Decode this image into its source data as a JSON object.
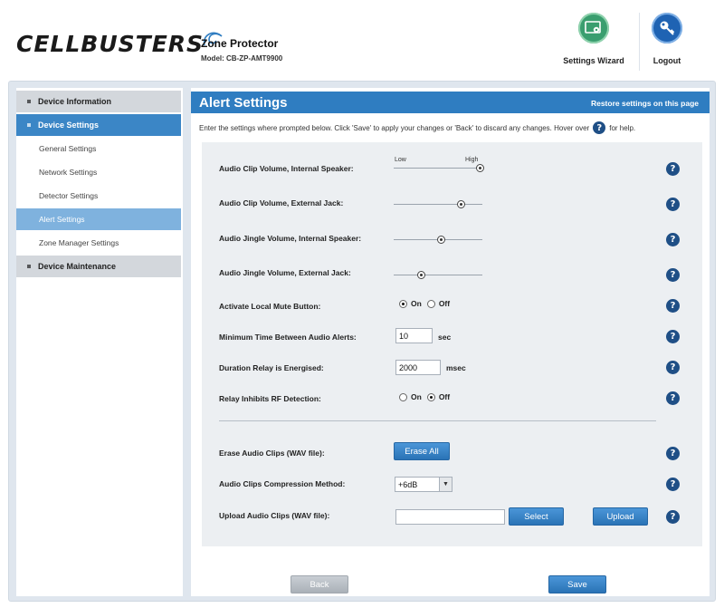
{
  "header": {
    "logo_text": "CELLBUSTERS",
    "product_title": "Zone Protector",
    "product_model": "Model: CB-ZP-AMT9900",
    "wizard_label": "Settings Wizard",
    "logout_label": "Logout",
    "wizard_icon": "settings-wizard-icon",
    "logout_icon": "key-icon"
  },
  "sidebar": {
    "items": [
      {
        "label": "Device Information",
        "type": "group",
        "active": false
      },
      {
        "label": "Device Settings",
        "type": "group",
        "active": true
      },
      {
        "label": "General Settings",
        "type": "sub",
        "active": false
      },
      {
        "label": "Network Settings",
        "type": "sub",
        "active": false
      },
      {
        "label": "Detector Settings",
        "type": "sub",
        "active": false
      },
      {
        "label": "Alert Settings",
        "type": "sub",
        "active": true
      },
      {
        "label": "Zone Manager Settings",
        "type": "sub",
        "active": false
      },
      {
        "label": "Device Maintenance",
        "type": "group",
        "active": false
      }
    ]
  },
  "main": {
    "title": "Alert Settings",
    "restore_link": "Restore settings on this page",
    "instructions_before": "Enter the settings where prompted below. Click 'Save' to apply your changes or 'Back' to discard any changes. Hover over",
    "instructions_after": "for help.",
    "help_glyph": "?"
  },
  "form": {
    "slider_low_label": "Low",
    "slider_high_label": "High",
    "sliders": [
      {
        "label": "Audio Clip Volume, Internal Speaker:",
        "value_fraction": 0.97
      },
      {
        "label": "Audio Clip Volume, External Jack:",
        "value_fraction": 0.75
      },
      {
        "label": "Audio Jingle Volume, Internal Speaker:",
        "value_fraction": 0.53
      },
      {
        "label": "Audio Jingle Volume, External Jack:",
        "value_fraction": 0.31
      }
    ],
    "local_mute": {
      "label": "Activate Local Mute Button:",
      "on_label": "On",
      "off_label": "Off",
      "selected": "On"
    },
    "min_time": {
      "label": "Minimum Time Between Audio Alerts:",
      "value": "10",
      "unit": "sec"
    },
    "relay_duration": {
      "label": "Duration Relay is Energised:",
      "value": "2000",
      "unit": "msec"
    },
    "relay_inhibits": {
      "label": "Relay Inhibits RF Detection:",
      "on_label": "On",
      "off_label": "Off",
      "selected": "Off"
    },
    "erase": {
      "label": "Erase Audio Clips (WAV file):",
      "button": "Erase All"
    },
    "compression": {
      "label": "Audio Clips Compression Method:",
      "value": "+6dB"
    },
    "upload": {
      "label": "Upload Audio Clips (WAV file):",
      "value": "",
      "select_button": "Select",
      "upload_button": "Upload"
    }
  },
  "footer": {
    "back_label": "Back",
    "save_label": "Save"
  },
  "colors": {
    "accent": "#2f7dc1",
    "sidebar_active_group": "#3b86c6",
    "sidebar_active_sub": "#7fb2de",
    "help_icon": "#1f4f86"
  }
}
